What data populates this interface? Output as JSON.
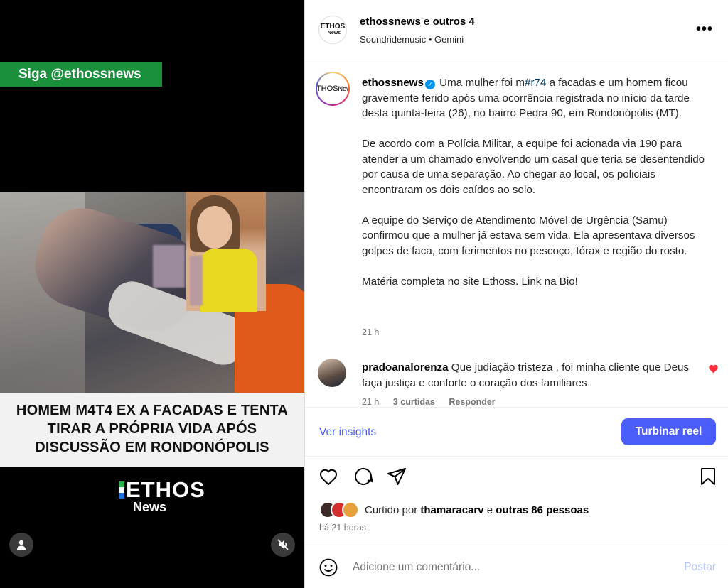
{
  "video": {
    "follow_banner": "Siga @ethossnews",
    "headline_lines": [
      "HOMEM M4T4 EX A FACADAS E TENTA",
      "TIRAR A PRÓPRIA VIDA APÓS",
      "DISCUSSÃO EM RONDONÓPOLIS"
    ],
    "logo_text": "ETHOS",
    "logo_sub": "News",
    "user_icon": "user-icon",
    "mute_icon": "muted-speaker-icon"
  },
  "header": {
    "author": "ethossnews",
    "connector": "e",
    "others": "outros 4",
    "subtitle": "Soundridemusic • Gemini",
    "more": "•••",
    "avatar_text": "ETHOS",
    "avatar_sub": "News"
  },
  "caption": {
    "author": "ethossnews",
    "part1": "Uma mulher foi m",
    "hashtag": "#r74",
    "part2": " a facadas e um homem ficou gravemente ferido após uma ocorrência registrada no início da tarde desta quinta-feira (26), no bairro Pedra 90, em Rondonópolis (MT).",
    "paragraph2": "De acordo com a Polícia Militar, a equipe foi acionada via 190 para atender a um chamado envolvendo um casal que teria se desentendido por causa de uma separação. Ao chegar ao local, os policiais encontraram os dois caídos ao solo.",
    "paragraph3": "A equipe do Serviço de Atendimento Móvel de Urgência (Samu) confirmou que a mulher já estava sem vida. Ela apresentava diversos golpes de faca, com ferimentos no pescoço, tórax e região do rosto.",
    "paragraph4": "Matéria completa no site Ethoss. Link na Bio!",
    "time": "21 h"
  },
  "comment": {
    "author": "pradoanalorenza",
    "text": "Que judiação tristeza , foi minha cliente que Deus faça justiça e conforte o coração dos familiares",
    "time": "21 h",
    "likes": "3 curtidas",
    "reply": "Responder"
  },
  "insights": {
    "link": "Ver insights",
    "boost": "Turbinar reel"
  },
  "likes": {
    "prefix": "Curtido por",
    "user": "thamaracarv",
    "connector": "e",
    "others": "outras 86 pessoas",
    "ago": "há 21 horas"
  },
  "add_comment": {
    "placeholder": "Adicione um comentário...",
    "post": "Postar"
  },
  "colors": {
    "accent": "#4a5df9",
    "banner_green": "#1a8f3c",
    "like_red": "#ff3040"
  }
}
